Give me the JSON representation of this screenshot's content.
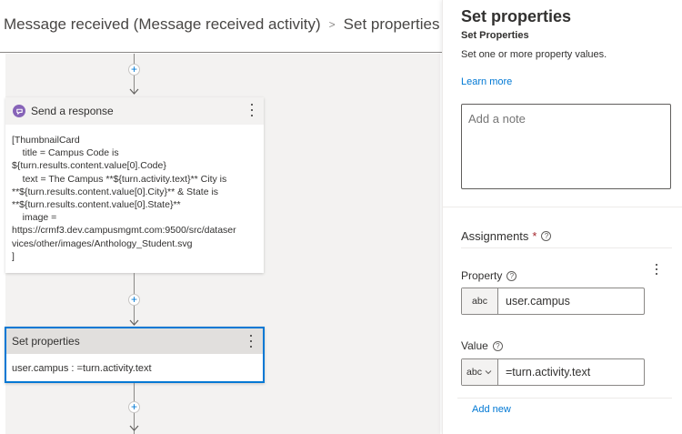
{
  "breadcrumb": {
    "parent": "Message received (Message received activity)",
    "separator": ">",
    "current": "Set properties"
  },
  "canvas": {
    "add_symbol": "+",
    "send_response": {
      "title": "Send a response",
      "body": "[ThumbnailCard\n    title = Campus Code is\n${turn.results.content.value[0].Code}\n    text = The Campus **${turn.activity.text}** City is\n**${turn.results.content.value[0].City}** & State is\n**${turn.results.content.value[0].State}**\n    image =\nhttps://crmf3.dev.campusmgmt.com:9500/src/dataser\nvices/other/images/Anthology_Student.svg\n]"
    },
    "set_properties": {
      "title": "Set properties",
      "body": "user.campus : =turn.activity.text"
    }
  },
  "panel": {
    "title": "Set properties",
    "subtitle": "Set Properties",
    "description": "Set one or more property values.",
    "learn_more": "Learn more",
    "note_placeholder": "Add a note",
    "assignments_label": "Assignments",
    "required_marker": "*",
    "property_label": "Property",
    "property_type": "abc",
    "property_value": "user.campus",
    "value_label": "Value",
    "value_type": "abc",
    "value_value": "=turn.activity.text",
    "add_new": "Add new",
    "help_glyph": "?"
  },
  "colors": {
    "accent": "#0078d4",
    "response_icon": "#8764b8",
    "required": "#a4262c"
  }
}
